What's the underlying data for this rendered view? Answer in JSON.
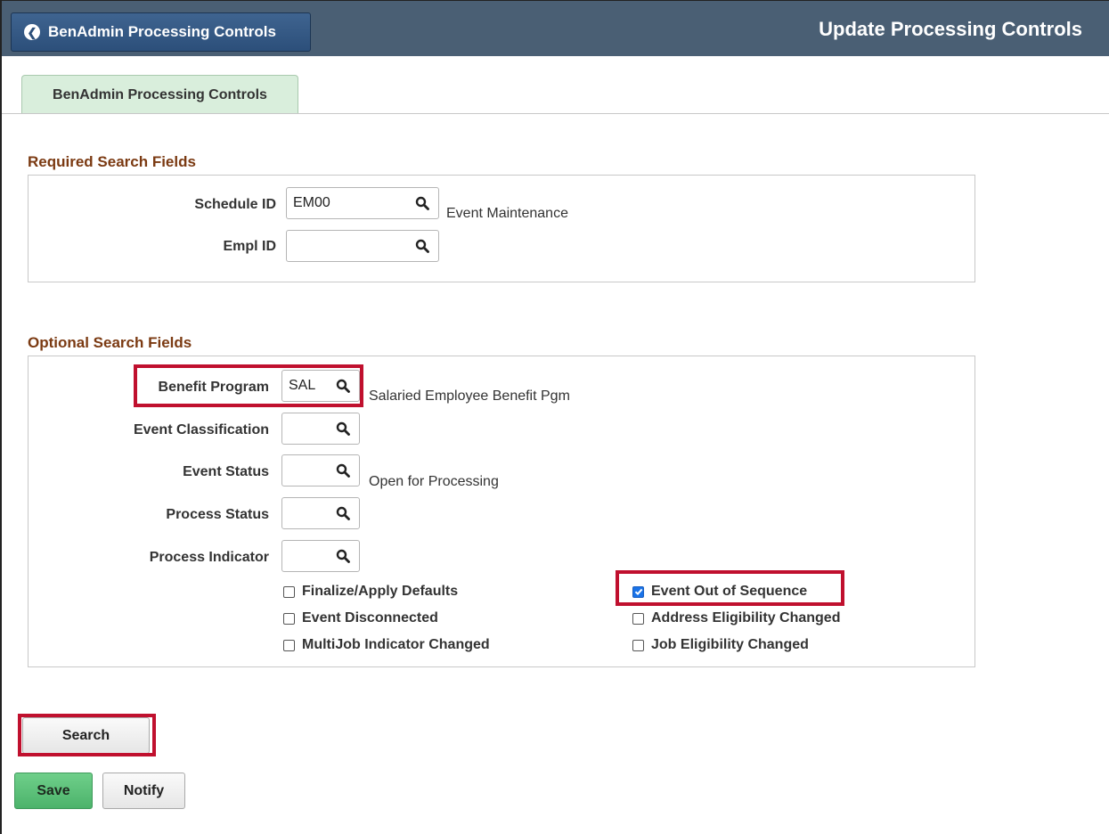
{
  "header": {
    "back_label": "BenAdmin Processing Controls",
    "title": "Update Processing Controls"
  },
  "tabs": [
    {
      "label": "BenAdmin Processing Controls",
      "active": true
    }
  ],
  "required": {
    "title": "Required Search Fields",
    "schedule_id": {
      "label": "Schedule ID",
      "value": "EM00",
      "description": "Event Maintenance"
    },
    "empl_id": {
      "label": "Empl ID",
      "value": ""
    }
  },
  "optional": {
    "title": "Optional Search Fields",
    "benefit_program": {
      "label": "Benefit Program",
      "value": "SAL",
      "description": "Salaried Employee Benefit Pgm"
    },
    "event_classification": {
      "label": "Event Classification",
      "value": ""
    },
    "event_status": {
      "label": "Event Status",
      "value": "",
      "description": "Open for Processing"
    },
    "process_status": {
      "label": "Process Status",
      "value": ""
    },
    "process_indicator": {
      "label": "Process Indicator",
      "value": ""
    },
    "checkboxes": {
      "finalize": {
        "label": "Finalize/Apply Defaults",
        "checked": false
      },
      "disconnected": {
        "label": "Event Disconnected",
        "checked": false
      },
      "multijob": {
        "label": "MultiJob Indicator Changed",
        "checked": false
      },
      "out_of_sequence": {
        "label": "Event Out of Sequence",
        "checked": true
      },
      "address_elig": {
        "label": "Address Eligibility Changed",
        "checked": false
      },
      "job_elig": {
        "label": "Job Eligibility Changed",
        "checked": false
      }
    }
  },
  "buttons": {
    "search": "Search",
    "save": "Save",
    "notify": "Notify"
  },
  "colors": {
    "header_bg": "#4a5f74",
    "section_title": "#7b3a12",
    "highlight": "#c0102e",
    "save_button": "#4cb36b",
    "tab_bg": "#d9eedc"
  }
}
